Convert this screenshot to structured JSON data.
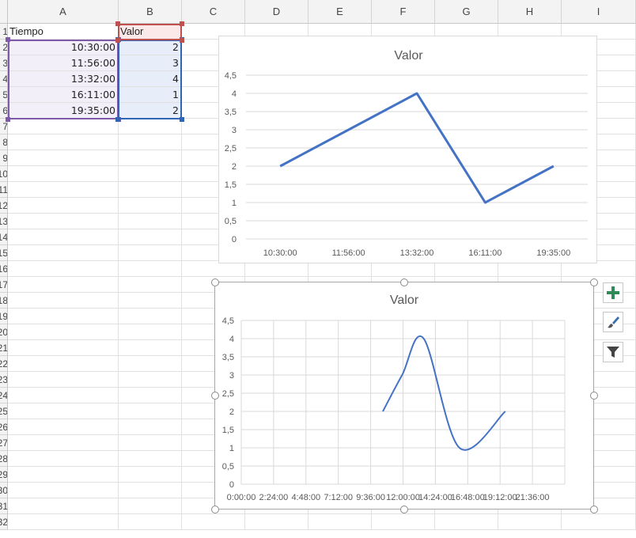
{
  "sheet": {
    "columns": [
      "A",
      "B",
      "C",
      "D",
      "E",
      "F",
      "G",
      "H",
      "I"
    ],
    "rows": [
      "1",
      "2",
      "3",
      "4",
      "5",
      "6",
      "7",
      "8",
      "9",
      "10",
      "11",
      "12",
      "13",
      "14",
      "15",
      "16",
      "17",
      "18",
      "19",
      "20",
      "21",
      "22",
      "23",
      "24",
      "25",
      "26",
      "27",
      "28",
      "29",
      "30",
      "31",
      "32"
    ],
    "cells": {
      "A1": "Tiempo",
      "B1": "Valor",
      "A2": "10:30:00",
      "B2": "2",
      "A3": "11:56:00",
      "B3": "3",
      "A4": "13:32:00",
      "B4": "4",
      "A5": "16:11:00",
      "B5": "1",
      "A6": "19:35:00",
      "B6": "2"
    },
    "colors": {
      "accent_purple": "#7f5aa8",
      "accent_blue": "#2f64b6",
      "accent_red": "#c0504d",
      "series": "#4472c4"
    }
  },
  "chart_data": [
    {
      "type": "line",
      "title": "Valor",
      "categories": [
        "10:30:00",
        "11:56:00",
        "13:32:00",
        "16:11:00",
        "19:35:00"
      ],
      "series": [
        {
          "values": [
            2,
            3,
            4,
            1,
            2
          ]
        }
      ],
      "ylim": [
        0,
        4.5
      ],
      "yticks": [
        "0",
        "0,5",
        "1",
        "1,5",
        "2",
        "2,5",
        "3",
        "3,5",
        "4",
        "4,5"
      ],
      "grid": true,
      "xlabel": "",
      "ylabel": ""
    },
    {
      "type": "scatter",
      "title": "Valor",
      "x": [
        "10:30:00",
        "11:56:00",
        "13:32:00",
        "16:11:00",
        "19:35:00"
      ],
      "series": [
        {
          "values": [
            2,
            3,
            4,
            1,
            2
          ]
        }
      ],
      "ylim": [
        0,
        4.5
      ],
      "yticks": [
        "0",
        "0,5",
        "1",
        "1,5",
        "2",
        "2,5",
        "3",
        "3,5",
        "4",
        "4,5"
      ],
      "xticks": [
        "0:00:00",
        "2:24:00",
        "4:48:00",
        "7:12:00",
        "9:36:00",
        "12:00:00",
        "14:24:00",
        "16:48:00",
        "19:12:00",
        "21:36:00"
      ],
      "smooth": true,
      "grid": true,
      "selected": true,
      "xlabel": "",
      "ylabel": ""
    }
  ],
  "chart_tools": [
    {
      "icon": "plus-icon"
    },
    {
      "icon": "brush-icon"
    },
    {
      "icon": "filter-icon"
    }
  ]
}
